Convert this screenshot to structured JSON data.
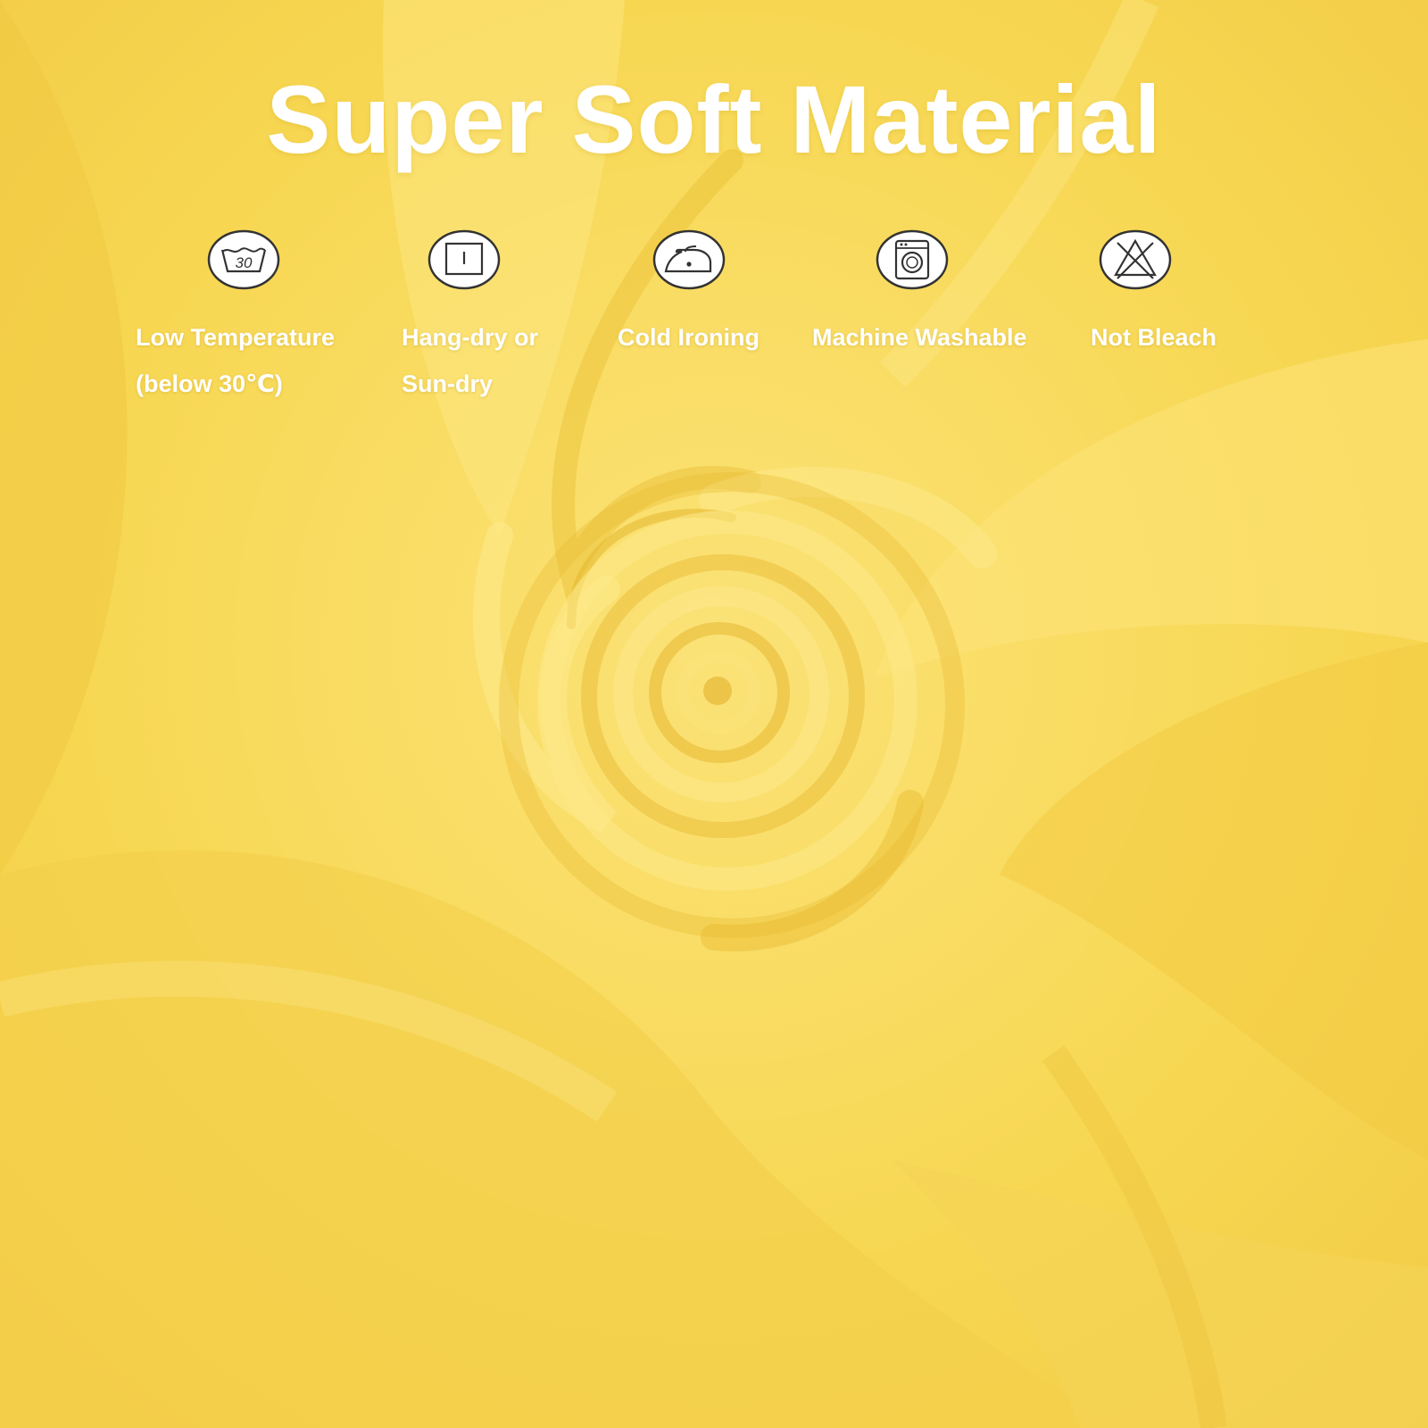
{
  "title": "Super Soft Material",
  "colors": {
    "fabric_base": "#f7d752",
    "fabric_light": "#fde98a",
    "fabric_shadow": "#e6b92c",
    "text": "#ffffff",
    "icon_stroke": "#333333"
  },
  "care_instructions": [
    {
      "icon": "wash-30-icon",
      "line1": "Low Temperature",
      "line2": "(below 30℃)"
    },
    {
      "icon": "hang-dry-icon",
      "line1": "Hang-dry or",
      "line2": "Sun-dry"
    },
    {
      "icon": "cold-iron-icon",
      "line1": "Cold Ironing",
      "line2": ""
    },
    {
      "icon": "machine-wash-icon",
      "line1": "Machine Washable",
      "line2": ""
    },
    {
      "icon": "no-bleach-icon",
      "line1": "Not Bleach",
      "line2": ""
    }
  ],
  "wash_temp": "30"
}
